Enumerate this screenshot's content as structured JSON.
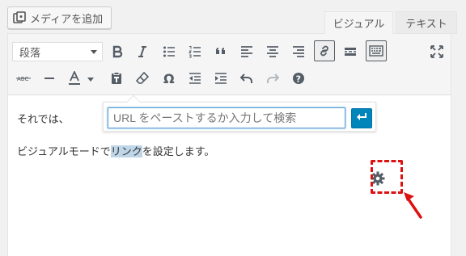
{
  "header": {
    "media_button_label": "メディアを追加",
    "tabs": [
      {
        "label": "ビジュアル",
        "active": true
      },
      {
        "label": "テキスト",
        "active": false
      }
    ]
  },
  "toolbar": {
    "format_select_value": "段落",
    "row1_icons": [
      "bold-icon",
      "italic-icon",
      "bulleted-list-icon",
      "numbered-list-icon",
      "blockquote-icon",
      "align-left-icon",
      "align-center-icon",
      "align-right-icon",
      "link-icon",
      "read-more-icon",
      "toolbar-toggle-icon"
    ],
    "row2_icons": [
      "strikethrough-icon",
      "horizontal-line-icon",
      "text-color-icon",
      "paste-as-text-icon",
      "clear-formatting-icon",
      "special-character-icon",
      "outdent-icon",
      "indent-icon",
      "undo-icon",
      "redo-icon",
      "help-icon"
    ],
    "fullscreen_icon": "fullscreen-icon"
  },
  "content": {
    "para1": "それでは、",
    "para2_before": "ビジュアルモードで",
    "para2_link": "リンク",
    "para2_after": "を設定します。"
  },
  "link_popup": {
    "url_placeholder": "URL をペーストするか入力して検索",
    "url_value": "",
    "apply_icon": "enter-icon",
    "settings_icon": "gear-icon"
  },
  "colors": {
    "accent": "#0085ba",
    "highlight": "#bfd6e8",
    "annotation": "#dd1111"
  }
}
